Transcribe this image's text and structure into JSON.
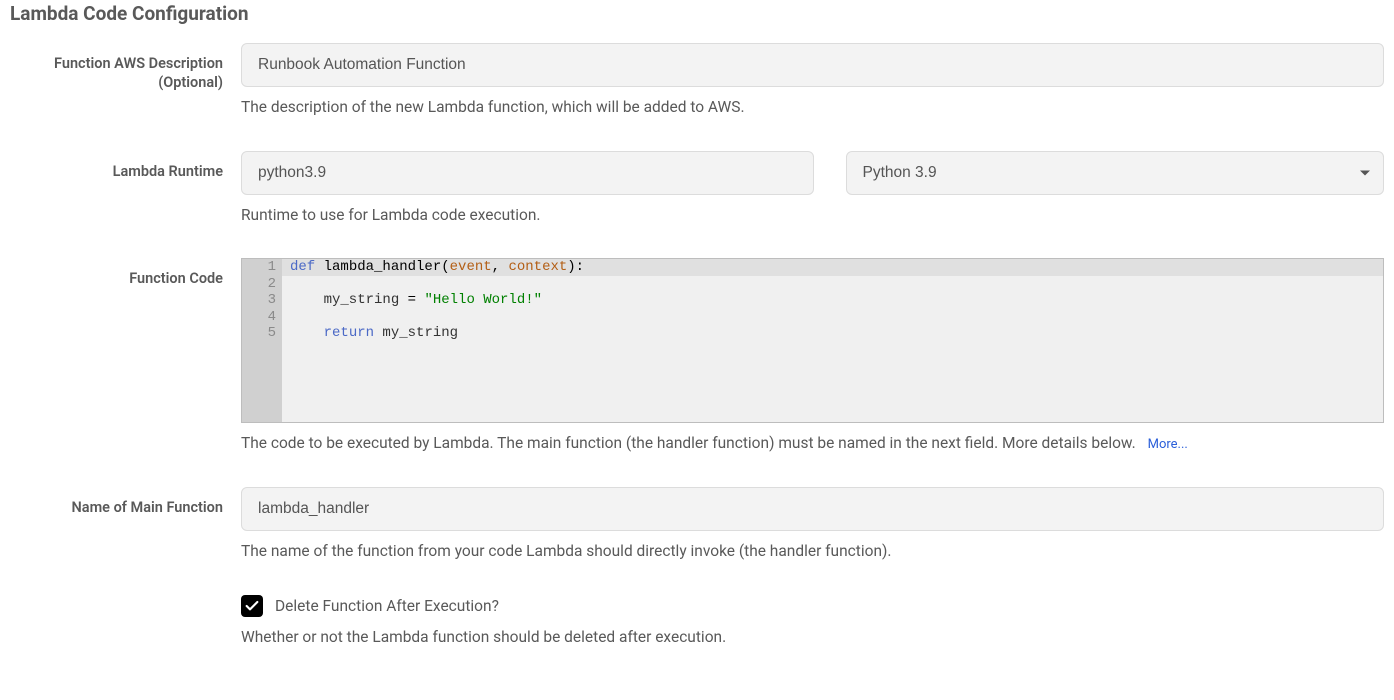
{
  "section_title": "Lambda Code Configuration",
  "fields": {
    "description": {
      "label": "Function AWS Description (Optional)",
      "value": "Runbook Automation Function",
      "help": "The description of the new Lambda function, which will be added to AWS."
    },
    "runtime": {
      "label": "Lambda Runtime",
      "value": "python3.9",
      "select_value": "Python 3.9",
      "help": "Runtime to use for Lambda code execution."
    },
    "code": {
      "label": "Function Code",
      "lines": [
        {
          "n": 1,
          "tokens": [
            {
              "t": "def ",
              "c": "kw"
            },
            {
              "t": "lambda_handler",
              "c": "fn"
            },
            {
              "t": "(",
              "c": "op"
            },
            {
              "t": "event",
              "c": "param"
            },
            {
              "t": ", ",
              "c": "op"
            },
            {
              "t": "context",
              "c": "param"
            },
            {
              "t": "):",
              "c": "op"
            }
          ],
          "active": true
        },
        {
          "n": 2,
          "tokens": []
        },
        {
          "n": 3,
          "tokens": [
            {
              "t": "    my_string ",
              "c": ""
            },
            {
              "t": "=",
              "c": "op"
            },
            {
              "t": " ",
              "c": ""
            },
            {
              "t": "\"Hello World!\"",
              "c": "str"
            }
          ]
        },
        {
          "n": 4,
          "tokens": []
        },
        {
          "n": 5,
          "tokens": [
            {
              "t": "    ",
              "c": ""
            },
            {
              "t": "return",
              "c": "ret"
            },
            {
              "t": " my_string",
              "c": ""
            }
          ]
        }
      ],
      "help": "The code to be executed by Lambda. The main function (the handler function) must be named in the next field. More details below.",
      "more_label": "More..."
    },
    "main_fn": {
      "label": "Name of Main Function",
      "value": "lambda_handler",
      "help": "The name of the function from your code Lambda should directly invoke (the handler function)."
    },
    "delete_after": {
      "checked": true,
      "label": "Delete Function After Execution?",
      "help": "Whether or not the Lambda function should be deleted after execution."
    }
  }
}
